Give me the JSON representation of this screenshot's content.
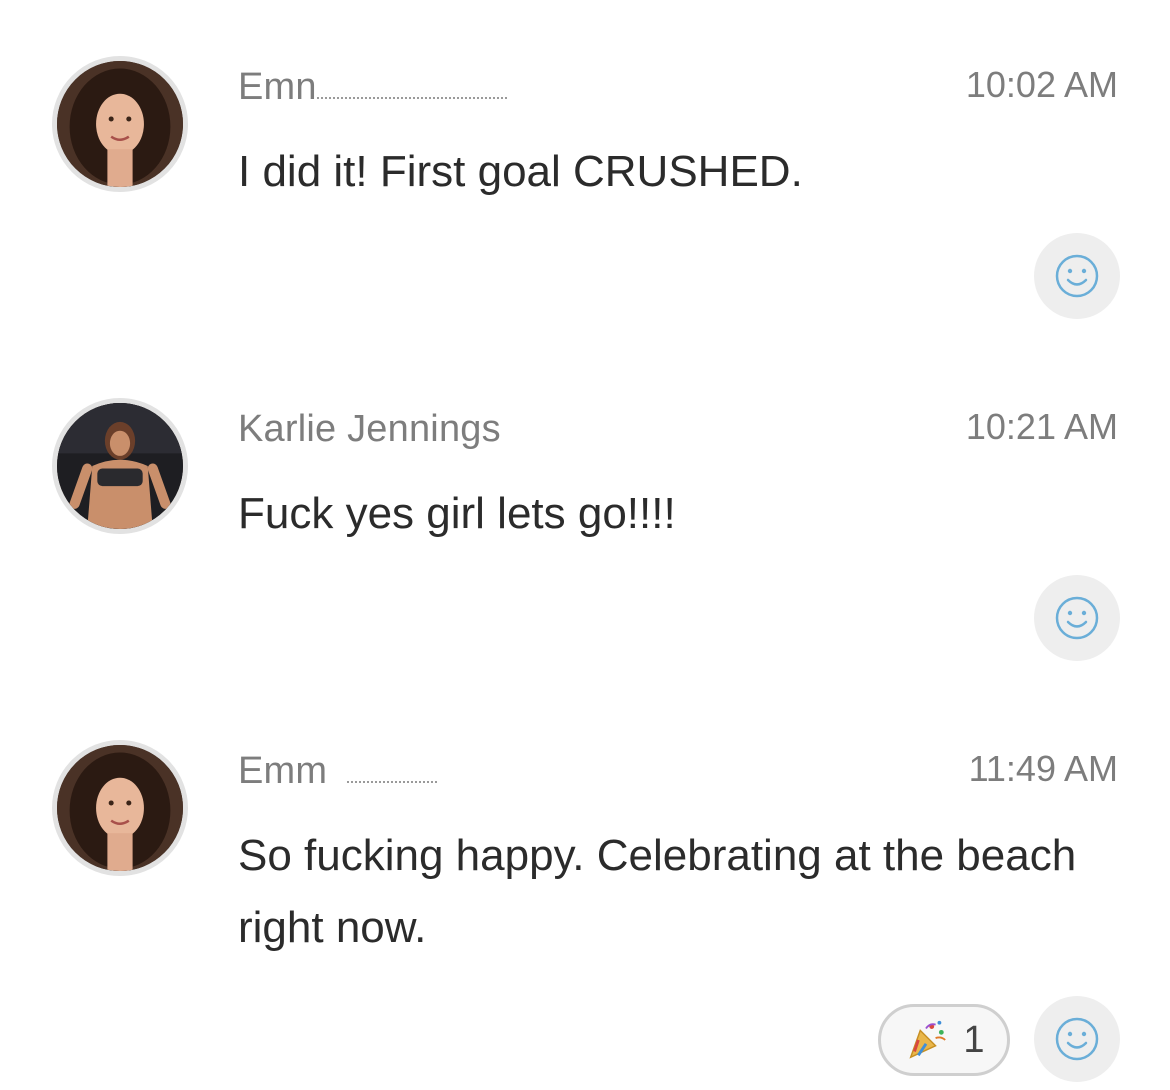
{
  "messages": [
    {
      "sender": "Emn",
      "time": "10:02 AM",
      "text": "I did it! First goal CRUSHED.",
      "avatar_icon": "woman-curly-hair-avatar",
      "add_reaction_icon": "smiley-icon"
    },
    {
      "sender": "Karlie Jennings",
      "time": "10:21 AM",
      "text": "Fuck yes girl lets go!!!!",
      "avatar_icon": "fitness-woman-avatar",
      "add_reaction_icon": "smiley-icon"
    },
    {
      "sender": "Emm",
      "time": "11:49 AM",
      "text": "So fucking happy. Celebrating at the beach right now.",
      "avatar_icon": "woman-curly-hair-avatar",
      "add_reaction_icon": "smiley-icon",
      "reactions": [
        {
          "emoji": "party-popper-icon",
          "count": "1"
        }
      ]
    }
  ],
  "colors": {
    "smiley": "#6aaed8",
    "meta_text": "#7d7d7d",
    "body_text": "#2b2b2b",
    "react_bg": "#eeeeee"
  }
}
